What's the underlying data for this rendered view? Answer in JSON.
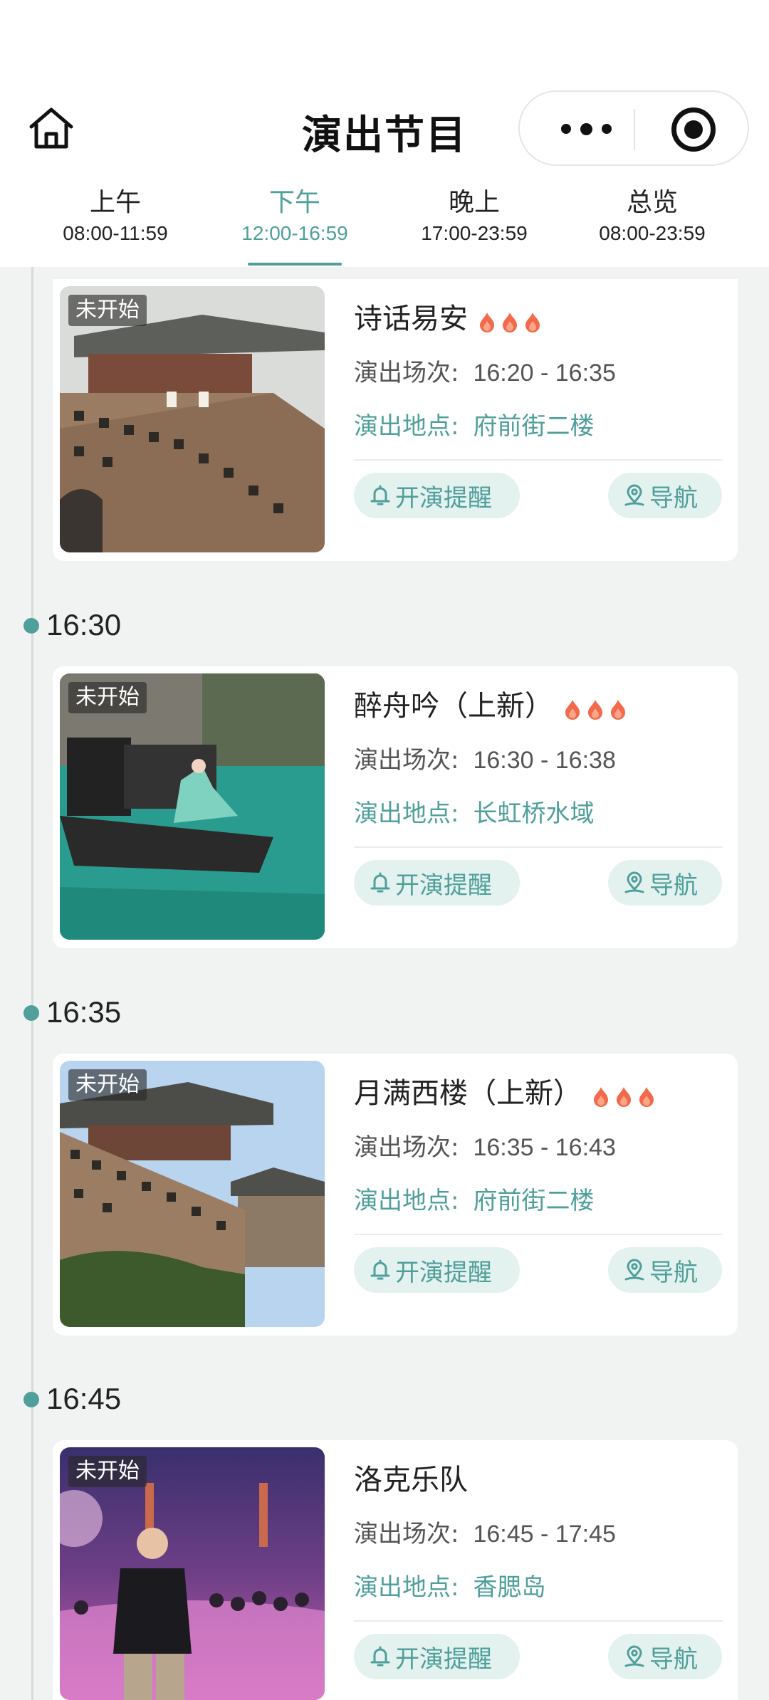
{
  "header": {
    "title": "演出节目"
  },
  "tabs": [
    {
      "label": "上午",
      "range": "08:00-11:59"
    },
    {
      "label": "下午",
      "range": "12:00-16:59"
    },
    {
      "label": "晚上",
      "range": "17:00-23:59"
    },
    {
      "label": "总览",
      "range": "08:00-23:59"
    }
  ],
  "active_tab": "下午",
  "labels": {
    "session": "演出场次:",
    "venue": "演出地点:",
    "remind": "开演提醒",
    "navigate": "导航"
  },
  "colors": {
    "accent": "#4f9f9a",
    "pill_bg": "#e3f1ef",
    "flame": "#f26a4b",
    "background": "#f1f3f2"
  },
  "time_groups": [
    {
      "time": "16:30"
    },
    {
      "time": "16:35"
    },
    {
      "time": "16:45"
    }
  ],
  "shows": [
    {
      "status": "未开始",
      "title": "诗话易安",
      "popularity": 3,
      "time": "16:20 - 16:35",
      "venue": "府前街二楼"
    },
    {
      "status": "未开始",
      "title": "醉舟吟（上新）",
      "popularity": 3,
      "time": "16:30 - 16:38",
      "venue": "长虹桥水域"
    },
    {
      "status": "未开始",
      "title": "月满西楼（上新）",
      "popularity": 3,
      "time": "16:35 - 16:43",
      "venue": "府前街二楼"
    },
    {
      "status": "未开始",
      "title": "洛克乐队",
      "popularity": 0,
      "time": "16:45 - 17:45",
      "venue": "香腮岛"
    }
  ]
}
